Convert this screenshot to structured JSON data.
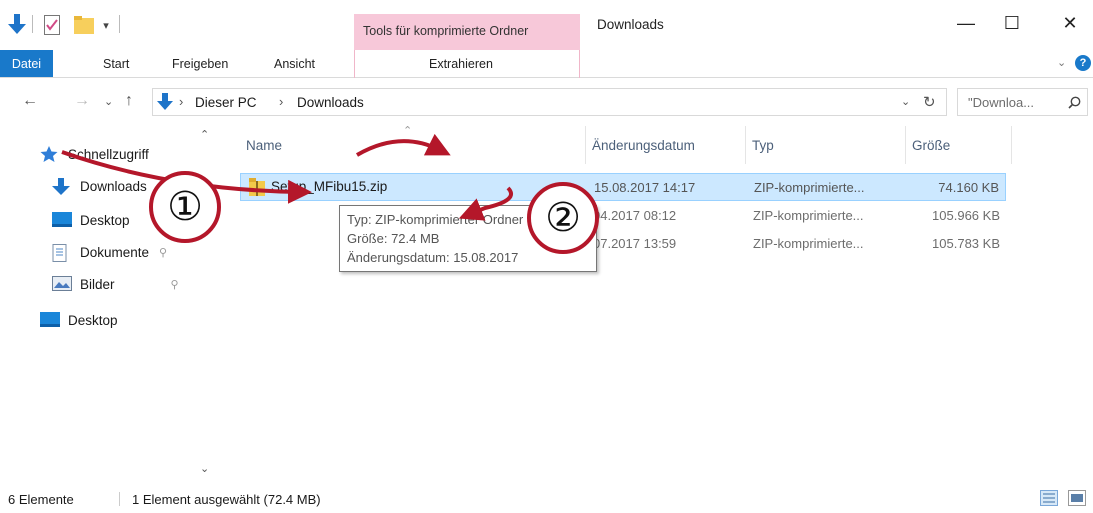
{
  "window": {
    "title": "Downloads",
    "context_tab": "Tools für komprimierte Ordner",
    "controls": {
      "minimize": "—",
      "maximize": "☐",
      "close": "✕"
    }
  },
  "ribbon": {
    "tabs": [
      "Datei",
      "Start",
      "Freigeben",
      "Ansicht"
    ],
    "context_subtab": "Extrahieren",
    "help": "?"
  },
  "address": {
    "path": [
      "Dieser PC",
      "Downloads"
    ],
    "search_placeholder": "\"Downloa...",
    "refresh": "↻"
  },
  "nav": {
    "items": [
      {
        "label": "Schnellzugriff",
        "icon": "star-icon"
      },
      {
        "label": "Downloads",
        "icon": "download-arrow-icon"
      },
      {
        "label": "Desktop",
        "icon": "desktop-icon"
      },
      {
        "label": "Dokumente",
        "icon": "document-icon"
      },
      {
        "label": "Bilder",
        "icon": "pictures-icon"
      },
      {
        "label": "Desktop",
        "icon": "desktop-icon"
      }
    ]
  },
  "columns": [
    "Name",
    "Änderungsdatum",
    "Typ",
    "Größe"
  ],
  "files": [
    {
      "name": "Setup_MFibu15.zip",
      "date": "15.08.2017 14:17",
      "type": "ZIP-komprimierte...",
      "size": "74.160 KB",
      "selected": true
    },
    {
      "name": "",
      "date": "04.2017 08:12",
      "type": "ZIP-komprimierte...",
      "size": "105.966 KB",
      "selected": false
    },
    {
      "name": "",
      "date": "07.2017 13:59",
      "type": "ZIP-komprimierte...",
      "size": "105.783 KB",
      "selected": false
    }
  ],
  "tooltip": {
    "type": "Typ: ZIP-komprimierter Ordner",
    "size": "Größe: 72.4 MB",
    "date": "Änderungsdatum: 15.08.2017"
  },
  "annotations": {
    "step1": "①",
    "step2": "②",
    "color": "#b4172a"
  },
  "status": {
    "count": "6 Elemente",
    "selection": "1 Element ausgewählt (72.4 MB)"
  },
  "colors": {
    "accent": "#1979ca",
    "context_tab": "#f7c8d9",
    "selection": "#cce8ff"
  }
}
